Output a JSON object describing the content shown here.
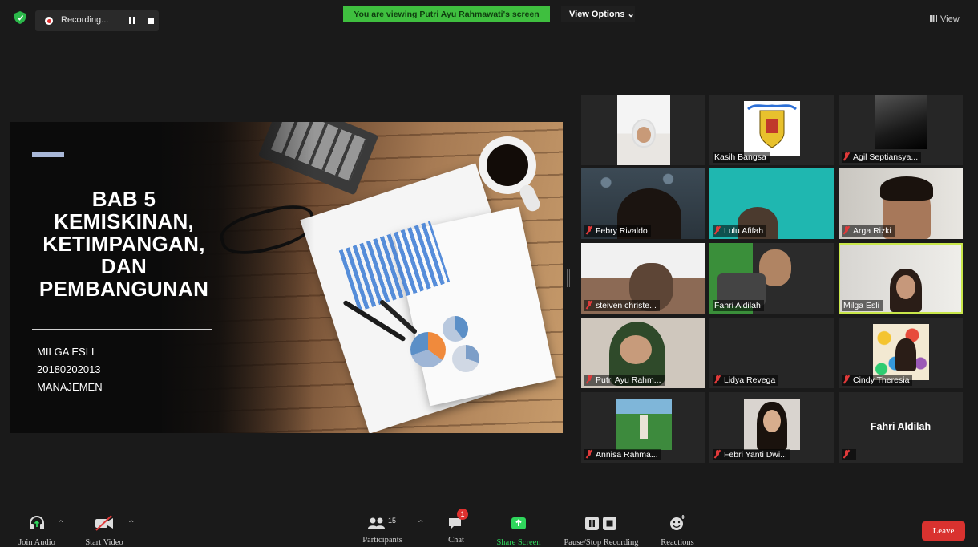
{
  "topbar": {
    "recording_label": "Recording...",
    "viewing_banner": "You are viewing Putri Ayu Rahmawati's screen",
    "view_options_label": "View Options ⌄",
    "view_label": "View",
    "banner_color": "#3fbf3f"
  },
  "slide": {
    "title_lines": [
      "BAB 5",
      "KEMISKINAN,",
      "KETIMPANGAN,",
      "DAN",
      "PEMBANGUNAN"
    ],
    "author": "MILGA ESLI",
    "student_id": "20180202013",
    "department": "MANAJEMEN"
  },
  "participants": [
    {
      "name": "",
      "muted": false
    },
    {
      "name": "Kasih Bangsa",
      "muted": false
    },
    {
      "name": "Agil Septiansya...",
      "muted": true
    },
    {
      "name": "Febry Rivaldo",
      "muted": true
    },
    {
      "name": "Lulu Afifah",
      "muted": true
    },
    {
      "name": "Arga Rizki",
      "muted": true
    },
    {
      "name": "steiven christe...",
      "muted": true
    },
    {
      "name": "Fahri Aldilah",
      "muted": false
    },
    {
      "name": "Milga Esli",
      "muted": false,
      "active_speaker": true
    },
    {
      "name": "Putri Ayu Rahm...",
      "muted": true
    },
    {
      "name": "Lidya Revega",
      "muted": true
    },
    {
      "name": "Cindy Theresia",
      "muted": true
    },
    {
      "name": "Annisa Rahma...",
      "muted": true
    },
    {
      "name": "Febri Yanti Dwi...",
      "muted": true
    },
    {
      "name": "",
      "display_name": "Fahri Aldilah",
      "muted": true
    }
  ],
  "toolbar": {
    "join_audio": "Join Audio",
    "start_video": "Start Video",
    "participants": "Participants",
    "participants_count": "15",
    "chat": "Chat",
    "chat_badge": "1",
    "share_screen": "Share Screen",
    "pause_stop_recording": "Pause/Stop Recording",
    "reactions": "Reactions",
    "leave": "Leave",
    "share_color": "#2fd65c",
    "leave_color": "#d9322f"
  }
}
